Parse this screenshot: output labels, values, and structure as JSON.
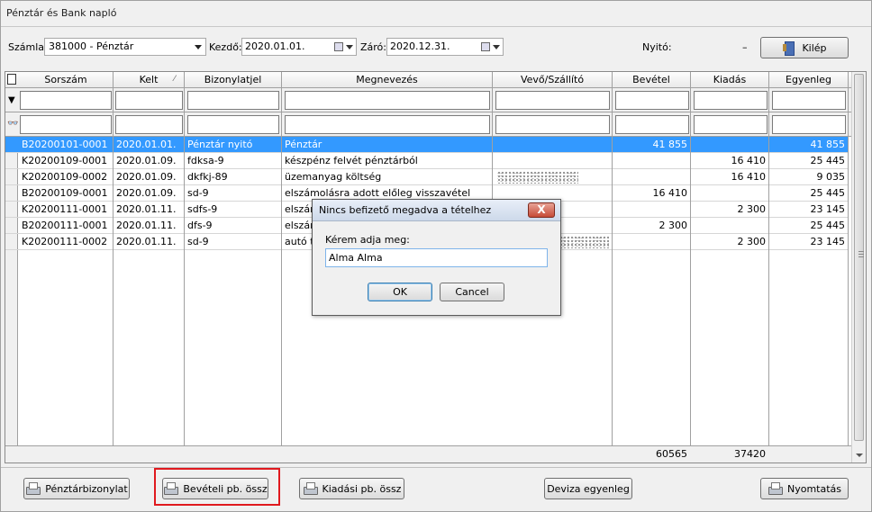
{
  "window": {
    "title": "Pénztár és Bank napló"
  },
  "toolbar": {
    "szamla_label": "Számla:",
    "szamla_value": "381000 - Pénztár",
    "kezdo_label": "Kezdő:",
    "kezdo_value": "2020.01.01.",
    "zaro_label": "Záró:",
    "zaro_value": "2020.12.31.",
    "nyito_label": "Nyitó:",
    "nyito_value": "–",
    "kilep_label": "Kilép"
  },
  "grid": {
    "columns": [
      "Sorszám",
      "Kelt",
      "Bizonylatjel",
      "Megnevezés",
      "Vevő/Szállító",
      "Bevétel",
      "Kiadás",
      "Egyenleg"
    ],
    "rows": [
      {
        "sorszam": "B20200101-0001",
        "kelt": "2020.01.01.",
        "biz": "Pénztár nyitó",
        "megn": "Pénztár",
        "vevo": "",
        "bevetel": "41 855",
        "kiadas": "",
        "egyenleg": "41 855"
      },
      {
        "sorszam": "K20200109-0001",
        "kelt": "2020.01.09.",
        "biz": "fdksa-9",
        "megn": "készpénz felvét pénztárból",
        "vevo": "",
        "bevetel": "",
        "kiadas": "16 410",
        "egyenleg": "25 445"
      },
      {
        "sorszam": "K20200109-0002",
        "kelt": "2020.01.09.",
        "biz": "dkfkj-89",
        "megn": "üzemanyag költség",
        "vevo": "",
        "bevetel": "",
        "kiadas": "16 410",
        "egyenleg": "9 035"
      },
      {
        "sorszam": "B20200109-0001",
        "kelt": "2020.01.09.",
        "biz": "sd-9",
        "megn": "elszámolásra adott előleg visszavétel",
        "vevo": "",
        "bevetel": "16 410",
        "kiadas": "",
        "egyenleg": "25 445"
      },
      {
        "sorszam": "K20200111-0001",
        "kelt": "2020.01.11.",
        "biz": "sdfs-9",
        "megn": "elszám",
        "vevo": "",
        "bevetel": "",
        "kiadas": "2 300",
        "egyenleg": "23 145"
      },
      {
        "sorszam": "B20200111-0001",
        "kelt": "2020.01.11.",
        "biz": "dfs-9",
        "megn": "elszám",
        "vevo": "",
        "bevetel": "2 300",
        "kiadas": "",
        "egyenleg": "25 445"
      },
      {
        "sorszam": "K20200111-0002",
        "kelt": "2020.01.11.",
        "biz": "sd-9",
        "megn": "autó ta",
        "vevo": "",
        "bevetel": "",
        "kiadas": "2 300",
        "egyenleg": "23 145"
      }
    ],
    "totals": {
      "bevetel": "60565",
      "kiadas": "37420"
    }
  },
  "buttons": {
    "penztarbizonylat": "Pénztárbizonylat",
    "beveteli": "Bevételi pb. össz",
    "kiadasi": "Kiadási pb. össz",
    "deviza": "Deviza egyenleg",
    "nyomtatas": "Nyomtatás"
  },
  "dialog": {
    "title": "Nincs befizető megadva a tételhez",
    "close": "X",
    "prompt": "Kérem adja meg:",
    "value": "Alma Alma",
    "ok": "OK",
    "cancel": "Cancel"
  },
  "colors": {
    "selection": "#3399ff",
    "highlight_border": "#e0191e"
  }
}
